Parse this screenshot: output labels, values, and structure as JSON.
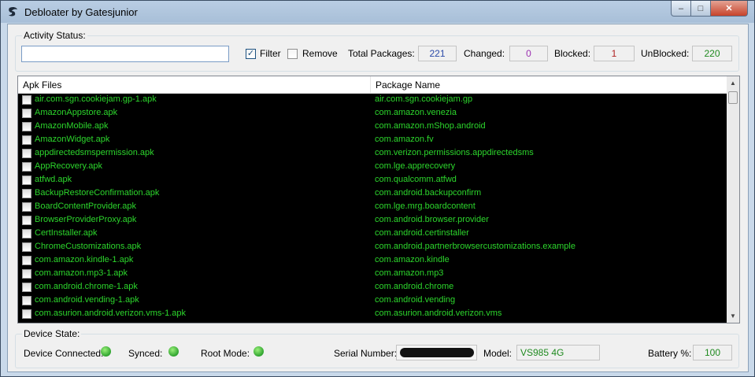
{
  "window": {
    "title": "Debloater by Gatesjunior",
    "minimize_glyph": "–",
    "maximize_glyph": "□",
    "close_glyph": "✕",
    "icon": "app-icon"
  },
  "activity": {
    "group_label": "Activity Status:",
    "status_value": "",
    "filter_label": "Filter",
    "filter_checked": true,
    "remove_label": "Remove",
    "remove_checked": false,
    "total_label": "Total Packages:",
    "total_value": "221",
    "changed_label": "Changed:",
    "changed_value": "0",
    "blocked_label": "Blocked:",
    "blocked_value": "1",
    "unblocked_label": "UnBlocked:",
    "unblocked_value": "220",
    "colors": {
      "total": "#2b4aa8",
      "changed": "#9b2fb0",
      "blocked": "#b02222",
      "unblocked": "#1f8a1f"
    }
  },
  "table": {
    "col_apk": "Apk Files",
    "col_pkg": "Package Name",
    "rows": [
      {
        "apk": "air.com.sgn.cookiejam.gp-1.apk",
        "pkg": "air.com.sgn.cookiejam.gp"
      },
      {
        "apk": "AmazonAppstore.apk",
        "pkg": "com.amazon.venezia"
      },
      {
        "apk": "AmazonMobile.apk",
        "pkg": "com.amazon.mShop.android"
      },
      {
        "apk": "AmazonWidget.apk",
        "pkg": "com.amazon.fv"
      },
      {
        "apk": "appdirectedsmspermission.apk",
        "pkg": "com.verizon.permissions.appdirectedsms"
      },
      {
        "apk": "AppRecovery.apk",
        "pkg": "com.lge.apprecovery"
      },
      {
        "apk": "atfwd.apk",
        "pkg": "com.qualcomm.atfwd"
      },
      {
        "apk": "BackupRestoreConfirmation.apk",
        "pkg": "com.android.backupconfirm"
      },
      {
        "apk": "BoardContentProvider.apk",
        "pkg": "com.lge.mrg.boardcontent"
      },
      {
        "apk": "BrowserProviderProxy.apk",
        "pkg": "com.android.browser.provider"
      },
      {
        "apk": "CertInstaller.apk",
        "pkg": "com.android.certinstaller"
      },
      {
        "apk": "ChromeCustomizations.apk",
        "pkg": "com.android.partnerbrowsercustomizations.example"
      },
      {
        "apk": "com.amazon.kindle-1.apk",
        "pkg": "com.amazon.kindle"
      },
      {
        "apk": "com.amazon.mp3-1.apk",
        "pkg": "com.amazon.mp3"
      },
      {
        "apk": "com.android.chrome-1.apk",
        "pkg": "com.android.chrome"
      },
      {
        "apk": "com.android.vending-1.apk",
        "pkg": "com.android.vending"
      },
      {
        "apk": "com.asurion.android.verizon.vms-1.apk",
        "pkg": "com.asurion.android.verizon.vms"
      }
    ]
  },
  "device": {
    "group_label": "Device State:",
    "connected_label": "Device Connected:",
    "synced_label": "Synced:",
    "root_label": "Root Mode:",
    "serial_label": "Serial Number:",
    "model_label": "Model:",
    "model_value": "VS985 4G",
    "battery_label": "Battery %:",
    "battery_value": "100",
    "indicator_color": "#2fa32f"
  }
}
